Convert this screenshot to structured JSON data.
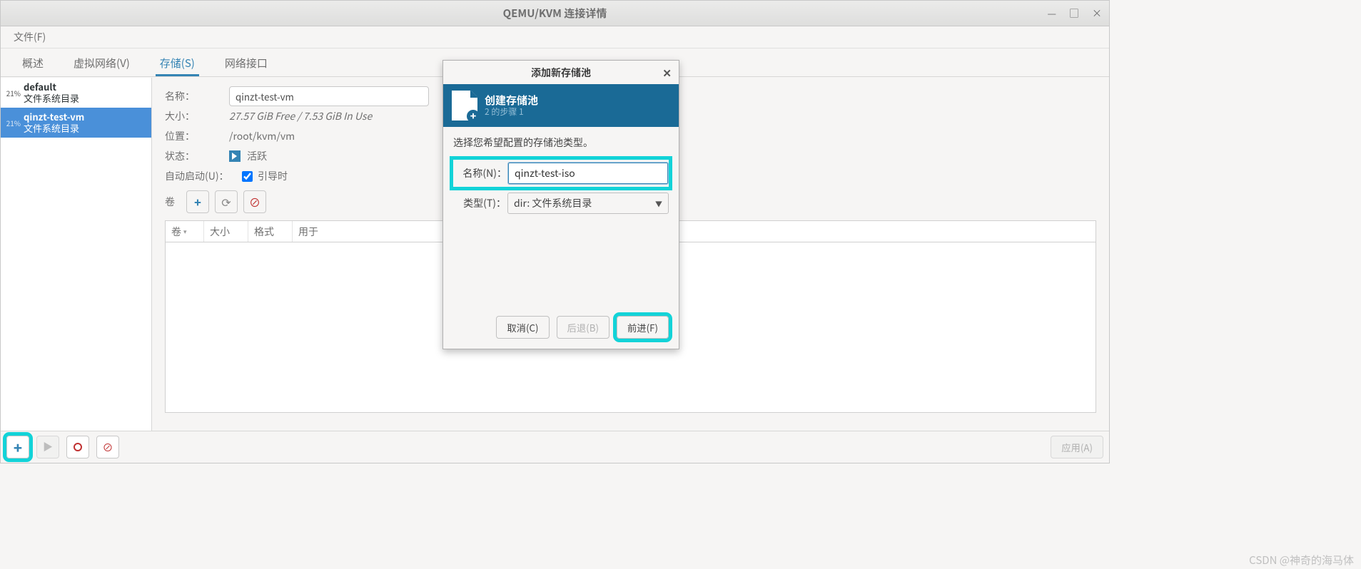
{
  "window": {
    "title": "QEMU/KVM 连接详情",
    "min_icon": "—",
    "max_icon": "□",
    "close_icon": "×"
  },
  "menubar": {
    "file": "文件(F)"
  },
  "tabs": {
    "overview": "概述",
    "vnet": "虚拟网络(V)",
    "storage": "存储(S)",
    "netif": "网络接口"
  },
  "pools": [
    {
      "pct": "21%",
      "name": "default",
      "sub": "文件系统目录",
      "selected": false
    },
    {
      "pct": "21%",
      "name": "qinzt-test-vm",
      "sub": "文件系统目录",
      "selected": true
    }
  ],
  "detail": {
    "labels": {
      "name": "名称：",
      "size": "大小：",
      "location": "位置：",
      "state": "状态：",
      "autostart": "自动启动(U)：",
      "volume": "卷"
    },
    "name_value": "qinzt-test-vm",
    "size_value": "27.57 GiB Free / 7.53 GiB In Use",
    "location_value": "/root/kvm/vm",
    "state_value": "活跃",
    "autostart_label": "引导时",
    "autostart_checked": true,
    "vol_cols": {
      "c1": "卷",
      "c2": "大小",
      "c3": "格式",
      "c4": "用于"
    }
  },
  "bottom": {
    "apply": "应用(A)"
  },
  "dialog": {
    "title": "添加新存储池",
    "banner_title": "创建存储池",
    "banner_sub": "2 的步骤 1",
    "prompt": "选择您希望配置的存储池类型。",
    "name_label": "名称(N)：",
    "name_value": "qinzt-test-iso",
    "type_label": "类型(T)：",
    "type_value": "dir: 文件系统目录",
    "buttons": {
      "cancel": "取消(C)",
      "back": "后退(B)",
      "forward": "前进(F)"
    }
  },
  "watermark": "CSDN @神奇的海马体"
}
